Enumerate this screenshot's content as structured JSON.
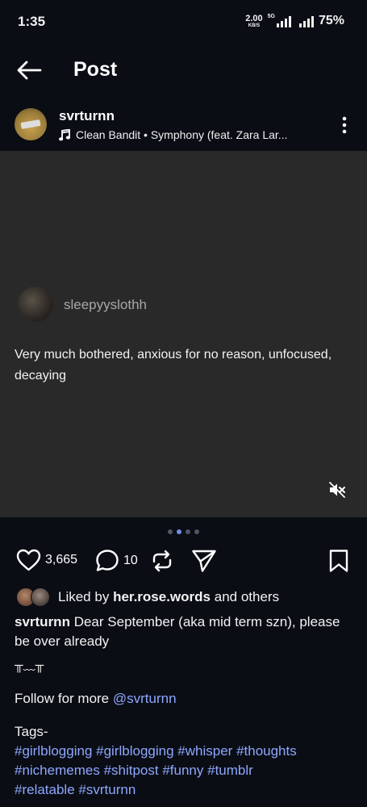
{
  "status_bar": {
    "time": "1:35",
    "speed_value": "2.00",
    "speed_unit": "KB/S",
    "network": "5G",
    "battery": "75%"
  },
  "header": {
    "title": "Post",
    "back_icon": "arrow-left-icon"
  },
  "author": {
    "username": "svrturnn",
    "music": "Clean Bandit • Symphony (feat. Zara Lar...",
    "music_icon": "music-note-icon",
    "more_icon": "more-vertical-icon"
  },
  "media": {
    "quoted_user": "sleepyyslothh",
    "quoted_text": "Very much bothered, anxious for no reason, unfocused, decaying",
    "mute_icon": "volume-off-icon",
    "page_count": 4,
    "active_page": 2
  },
  "actions": {
    "likes": "3,665",
    "comments": "10",
    "like_icon": "heart-icon",
    "comment_icon": "comment-icon",
    "repost_icon": "repost-icon",
    "share_icon": "send-icon",
    "save_icon": "bookmark-icon"
  },
  "liked_by": {
    "prefix": "Liked by",
    "user": "her.rose.words",
    "suffix": "and others"
  },
  "caption": {
    "username": "svrturnn",
    "text": "Dear September (aka mid term szn), please be over already",
    "emote": "╥﹏╥",
    "follow_prefix": "Follow for more",
    "follow_handle": "@svrturnn",
    "tags_label": "Tags-",
    "tags_line1": [
      "#girlblogging",
      "#girlblogging",
      "#whisper",
      "#thoughts"
    ],
    "tags_line2": [
      "#nichememes",
      "#shitpost",
      "#funny",
      "#tumblr"
    ],
    "tags_line3": [
      "#relatable",
      "#svrturnn"
    ]
  },
  "colors": {
    "background": "#0a0d14",
    "media_background": "#292929",
    "link": "#8ea7ff",
    "active_dot": "#6e8ee6"
  }
}
